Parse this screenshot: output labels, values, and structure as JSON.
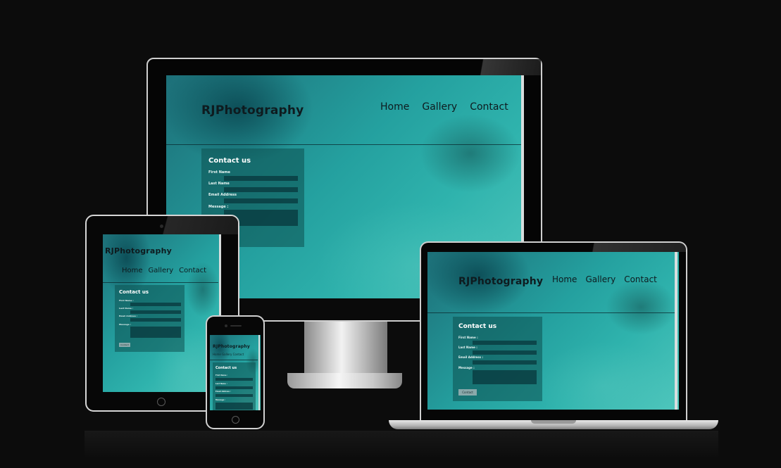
{
  "site": {
    "brand": "RJPhotography",
    "nav": [
      "Home",
      "Gallery",
      "Contact"
    ],
    "nav_inline": "Home Gallery Contact"
  },
  "form": {
    "title": "Contact us",
    "first_name": "First Name",
    "last_name": "Last Name",
    "email": "Email Address",
    "message": "Message :",
    "first_name_colon": "First Name :",
    "last_name_colon": "Last Name :",
    "email_colon": "Email Address :",
    "submit": "Contact"
  }
}
